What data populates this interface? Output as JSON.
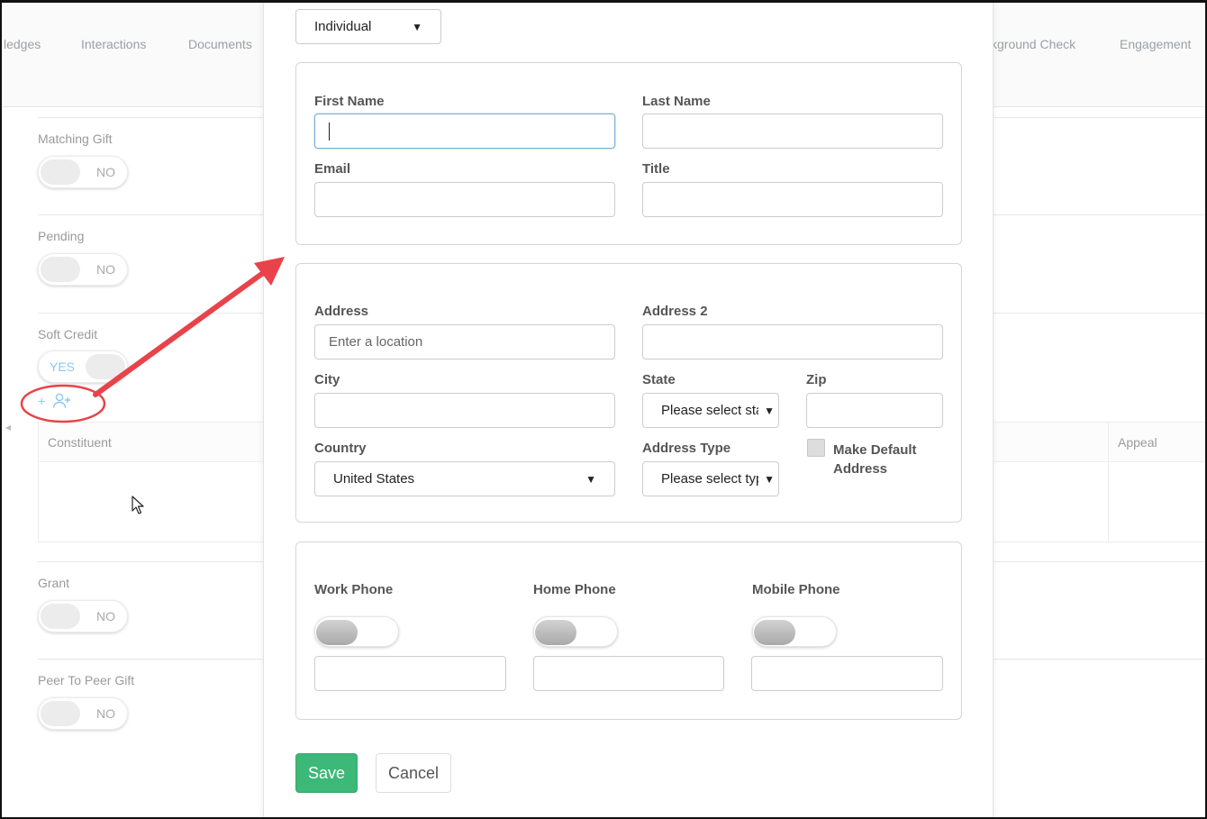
{
  "background": {
    "tabs": [
      "ledges",
      "Interactions",
      "Documents",
      "kground Check",
      "Engagement"
    ],
    "fields": [
      {
        "label": "Matching Gift",
        "state": "NO"
      },
      {
        "label": "Pending",
        "state": "NO"
      },
      {
        "label": "Soft Credit",
        "state": "YES"
      },
      {
        "label": "Grant",
        "state": "NO"
      },
      {
        "label": "Peer To Peer Gift",
        "state": "NO"
      }
    ],
    "soft_credit_actions": {
      "plus": "+"
    },
    "table_headers": [
      "Constituent",
      "Appeal"
    ]
  },
  "modal": {
    "type_select": "Individual",
    "personal": {
      "first_name_label": "First Name",
      "last_name_label": "Last Name",
      "email_label": "Email",
      "title_label": "Title"
    },
    "address": {
      "address_label": "Address",
      "address_placeholder": "Enter a location",
      "address2_label": "Address 2",
      "city_label": "City",
      "state_label": "State",
      "state_select": "Please select state",
      "zip_label": "Zip",
      "country_label": "Country",
      "country_select": "United States",
      "address_type_label": "Address Type",
      "address_type_select": "Please select type",
      "make_default_label": "Make Default Address"
    },
    "phones": {
      "work_label": "Work Phone",
      "home_label": "Home Phone",
      "mobile_label": "Mobile Phone"
    },
    "save_label": "Save",
    "cancel_label": "Cancel"
  },
  "colors": {
    "save_green": "#3cb878",
    "annotation_red": "#e8434a",
    "toggle_on_text": "#8ac8ee"
  }
}
